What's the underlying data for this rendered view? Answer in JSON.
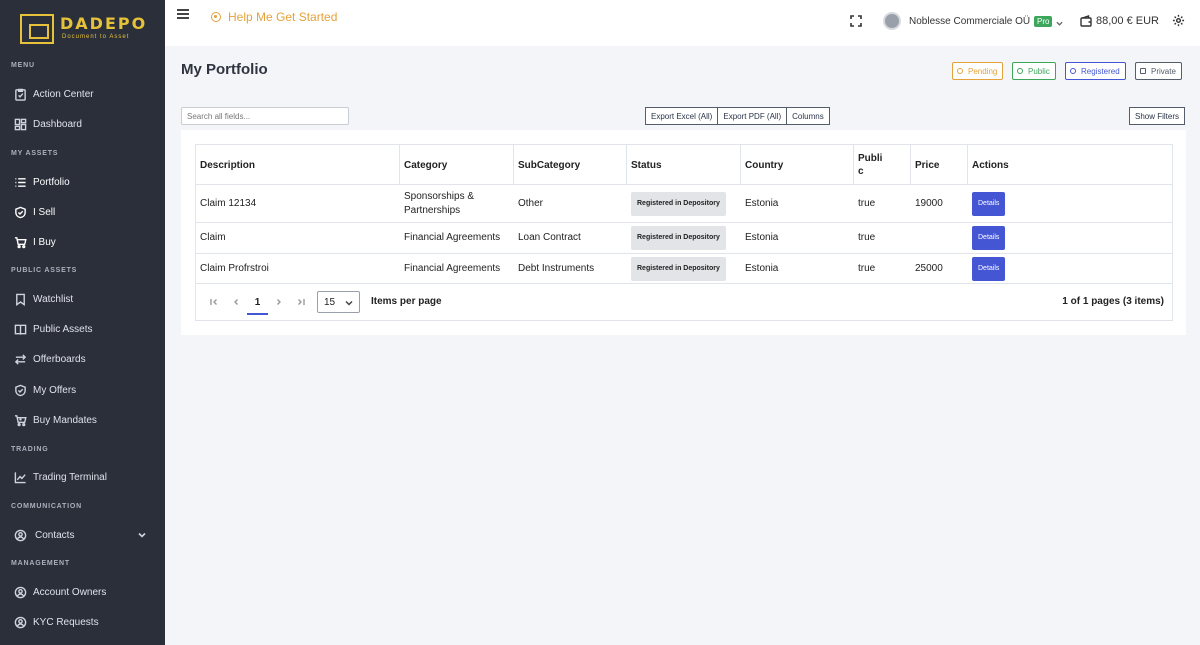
{
  "brand": {
    "name": "DADEPO",
    "tagline": "Document to Asset"
  },
  "sidebar": {
    "sections": {
      "menu": "MENU",
      "my_assets": "MY ASSETS",
      "public_assets": "PUBLIC ASSETS",
      "trading": "TRADING",
      "communication": "COMMUNICATION",
      "management": "MANAGEMENT"
    },
    "items": {
      "action_center": "Action Center",
      "dashboard": "Dashboard",
      "portfolio": "Portfolio",
      "i_sell": "I Sell",
      "i_buy": "I Buy",
      "watchlist": "Watchlist",
      "public_assets": "Public Assets",
      "offerboards": "Offerboards",
      "my_offers": "My Offers",
      "buy_mandates": "Buy Mandates",
      "trading_terminal": "Trading Terminal",
      "contacts": "Contacts",
      "account_owners": "Account Owners",
      "kyc_requests": "KYC Requests"
    }
  },
  "topbar": {
    "help": "Help Me Get Started",
    "company": "Noblesse Commerciale OÜ",
    "plan": "Pro",
    "balance": "88,00 € EUR"
  },
  "page": {
    "title": "My Portfolio",
    "legend": {
      "pending": "Pending",
      "public": "Public",
      "registered": "Registered",
      "private": "Private"
    }
  },
  "toolbar": {
    "search_placeholder": "Search all fields...",
    "export_excel": "Export Excel (All)",
    "export_pdf": "Export PDF (All)",
    "columns": "Columns",
    "show_filters": "Show Filters"
  },
  "table": {
    "headers": {
      "description": "Description",
      "category": "Category",
      "subcategory": "SubCategory",
      "status": "Status",
      "country": "Country",
      "public_line1": "Publi",
      "public_line2": "c",
      "price": "Price",
      "actions": "Actions"
    },
    "rows": [
      {
        "description": "Claim 12134",
        "category": "Sponsorships & Partnerships",
        "subcategory": "Other",
        "status": "Registered in Depository",
        "country": "Estonia",
        "public": "true",
        "price": "19000",
        "action": "Details"
      },
      {
        "description": "Claim",
        "category": "Financial Agreements",
        "subcategory": "Loan Contract",
        "status": "Registered in Depository",
        "country": "Estonia",
        "public": "true",
        "price": "",
        "action": "Details"
      },
      {
        "description": "Claim Profrstroi",
        "category": "Financial Agreements",
        "subcategory": "Debt Instruments",
        "status": "Registered in Depository",
        "country": "Estonia",
        "public": "true",
        "price": "25000",
        "action": "Details"
      }
    ],
    "pager": {
      "current_page": "1",
      "page_size": "15",
      "items_per_page": "Items per page",
      "info": "1 of 1 pages (3 items)"
    }
  },
  "colors": {
    "sidebar_bg": "#2b2f3a",
    "accent": "#4456d3",
    "pending": "#e3a23c",
    "public": "#3ca65a",
    "registered": "#4456d3",
    "private": "#555c6a",
    "brand": "#e6c13a"
  },
  "icons": {
    "action_center": "clipboard-icon",
    "dashboard": "grid-icon",
    "portfolio": "list-icon",
    "i_sell": "shield-check-icon",
    "i_buy": "cart-icon",
    "watchlist": "bookmark-icon",
    "public_assets": "book-icon",
    "offerboards": "arrows-icon",
    "my_offers": "shield-icon",
    "buy_mandates": "tag-cart-icon",
    "trading_terminal": "chart-line-icon",
    "contacts": "user-circle-icon",
    "account_owners": "user-circle-icon",
    "kyc_requests": "user-circle-icon"
  }
}
